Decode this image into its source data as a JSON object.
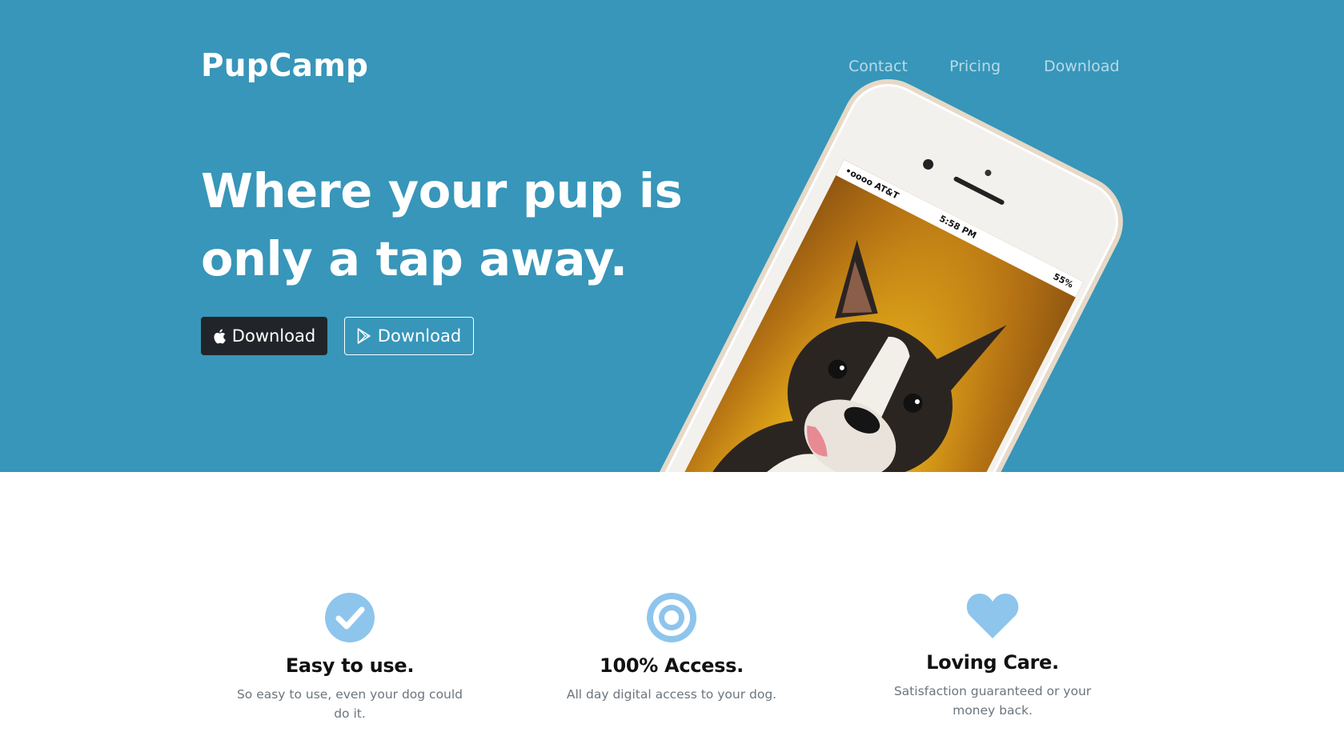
{
  "brand": {
    "name": "PupCamp"
  },
  "nav": {
    "contact": "Contact",
    "pricing": "Pricing",
    "download": "Download"
  },
  "hero": {
    "headline_line1": "Where your pup is",
    "headline_line2": "only a tap away.",
    "apple_button": "Download",
    "play_button": "Download"
  },
  "phone": {
    "carrier": "•oooo AT&T",
    "time": "5:58 PM",
    "battery": "55%"
  },
  "features": [
    {
      "title": "Easy to use.",
      "text": "So easy to use, even your dog could do it.",
      "icon": "check-circle-icon"
    },
    {
      "title": "100% Access.",
      "text": "All day digital access to your dog.",
      "icon": "target-icon"
    },
    {
      "title": "Loving Care.",
      "text": "Satisfaction guaranteed or your money back.",
      "icon": "heart-icon"
    }
  ],
  "colors": {
    "hero_bg": "#3796b9",
    "icon_blue": "#8ec5ec",
    "dark_button": "#212529"
  }
}
